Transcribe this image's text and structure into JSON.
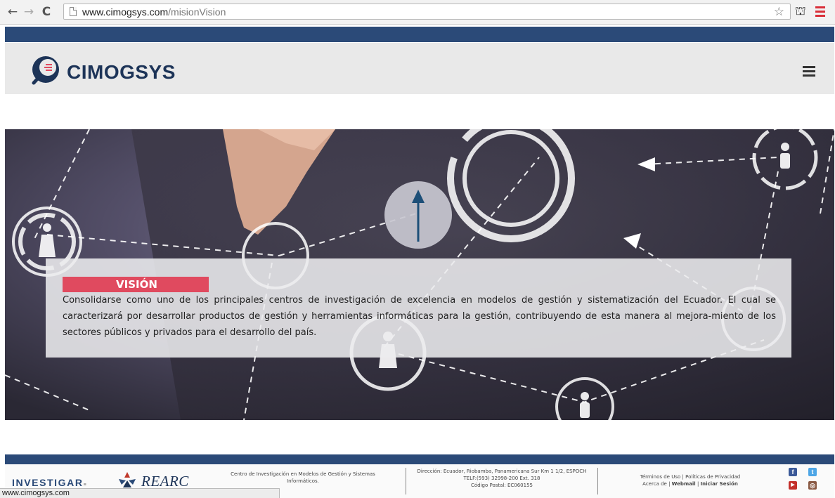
{
  "browser": {
    "url_domain": "www.cimogsys.com",
    "url_path": "/misionVision",
    "back_icon": "←",
    "forward_icon": "→",
    "reload_icon": "C",
    "star_icon": "☆",
    "extension_icon": "⛫",
    "status_text": "www.cimogsys.com"
  },
  "header": {
    "logo_text": "CIMOGSYS",
    "accent_color": "#2b4a78",
    "brand_red": "#e04a5f"
  },
  "vision": {
    "title": "VISIÓN",
    "text": "Consolidarse como uno de los principales centros de investigación de excelencia en modelos de gestión y sistematización del Ecuador. El cual se caracterizará por desarrollar productos de gestión y herramientas informáticas para la gestión, contribuyendo de esta manera al mejora-miento de los sectores públicos y privados para el desarrollo del país."
  },
  "footer": {
    "investigar": "INVESTIGAR",
    "investigar_small": "≡",
    "rearc": "REARC",
    "center_line1": "Centro de Investigación en Modelos de Gestión y Sistemas",
    "center_line2": "Informáticos.",
    "address_line1": "Dirección: Ecuador, Riobamba, Panamericana Sur Km 1 1/2, ESPOCH",
    "address_line2": "TELF:(593) 32998-200 Ext. 318",
    "address_line3": "Código Postal: EC060155",
    "links_terms": "Términos de Uso",
    "links_privacy": "Políticas de Privacidad",
    "links_about": "Acerca de",
    "links_webmail": "Webmail",
    "links_login": "Iniciar Sesión",
    "sep": "|",
    "social_facebook": "f",
    "social_twitter": "t",
    "social_youtube": "▶",
    "social_instagram": "◎"
  }
}
